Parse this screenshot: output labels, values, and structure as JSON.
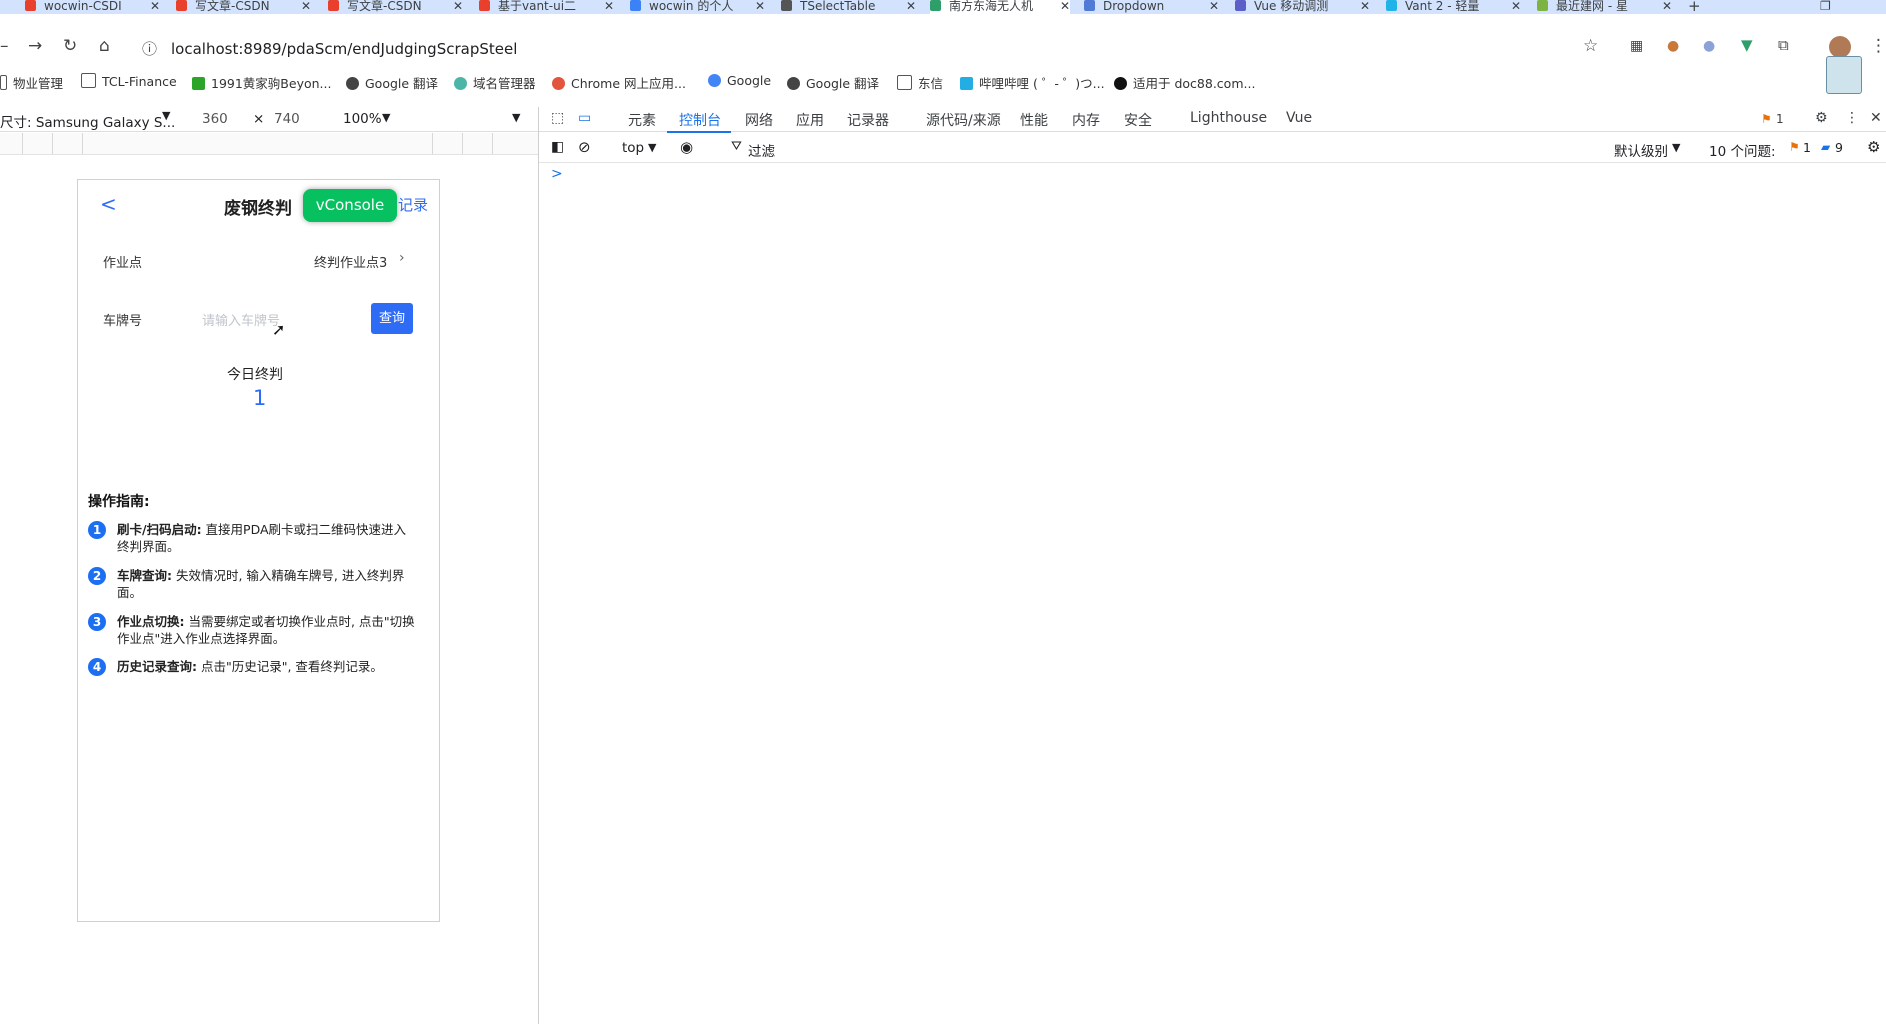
{
  "browser": {
    "tabs": [
      {
        "title": "wocwin-CSDI",
        "color": "#e8402c"
      },
      {
        "title": "写文章-CSDN",
        "color": "#e8402c"
      },
      {
        "title": "写文章-CSDN",
        "color": "#e8402c"
      },
      {
        "title": "基于vant-ui二",
        "color": "#e8402c"
      },
      {
        "title": "wocwin 的个人",
        "color": "#3b82f6"
      },
      {
        "title": "TSelectTable",
        "color": "#555555"
      },
      {
        "title": "南方东海无人机",
        "color": "#2e9e6b"
      },
      {
        "title": "Dropdown",
        "color": "#4f7bd6"
      },
      {
        "title": "Vue 移动调测",
        "color": "#5b5fc7"
      },
      {
        "title": "Vant 2 - 轻量",
        "color": "#1fb3e8"
      },
      {
        "title": "最近建网 - 星",
        "color": "#7cb342"
      }
    ],
    "new_tab": "+",
    "url": "localhost:8989/pdaScm/endJudgingScrapSteel",
    "bookmarks": [
      "物业管理",
      "TCL-Finance",
      "1991黄家驹Beyon...",
      "Google 翻译",
      "域名管理器",
      "Chrome 网上应用...",
      "Google",
      "Google 翻译",
      "东信",
      "哔哩哔哩 ( ゜- ゜)つ...",
      "适用于 doc88.com..."
    ]
  },
  "device_toolbar": {
    "device": "尺寸: Samsung Galaxy S...",
    "width": "360",
    "times": "×",
    "height": "740",
    "zoom": "100%"
  },
  "app": {
    "title": "废钢终判",
    "back": "<",
    "vconsole": "vConsole",
    "history": "记录",
    "site_label": "作业点",
    "site_value": "终判作业点3",
    "plate_label": "车牌号",
    "plate_placeholder": "请输入车牌号",
    "query": "查询",
    "today_label": "今日终判",
    "today_count": "1",
    "guide_title": "操作指南:",
    "guide": [
      {
        "num": "1",
        "bold": "刷卡/扫码启动:",
        "text": " 直接用PDA刷卡或扫二维码快速进入终判界面。"
      },
      {
        "num": "2",
        "bold": "车牌查询:",
        "text": " 失效情况时, 输入精确车牌号, 进入终判界面。"
      },
      {
        "num": "3",
        "bold": "作业点切换:",
        "text": " 当需要绑定或者切换作业点时, 点击\"切换作业点\"进入作业点选择界面。"
      },
      {
        "num": "4",
        "bold": "历史记录查询:",
        "text": " 点击\"历史记录\", 查看终判记录。"
      }
    ]
  },
  "devtools": {
    "tabs": [
      "元素",
      "控制台",
      "网络",
      "应用",
      "记录器",
      "源代码/来源",
      "性能",
      "内存",
      "安全",
      "Lighthouse",
      "Vue"
    ],
    "active_tab": "控制台",
    "errors": "1",
    "context": "top",
    "filter": "过滤",
    "level": "默认级别",
    "issues_label": "10 个问题:",
    "issues_errors": "1",
    "issues_info": "9",
    "prompt": ">"
  }
}
